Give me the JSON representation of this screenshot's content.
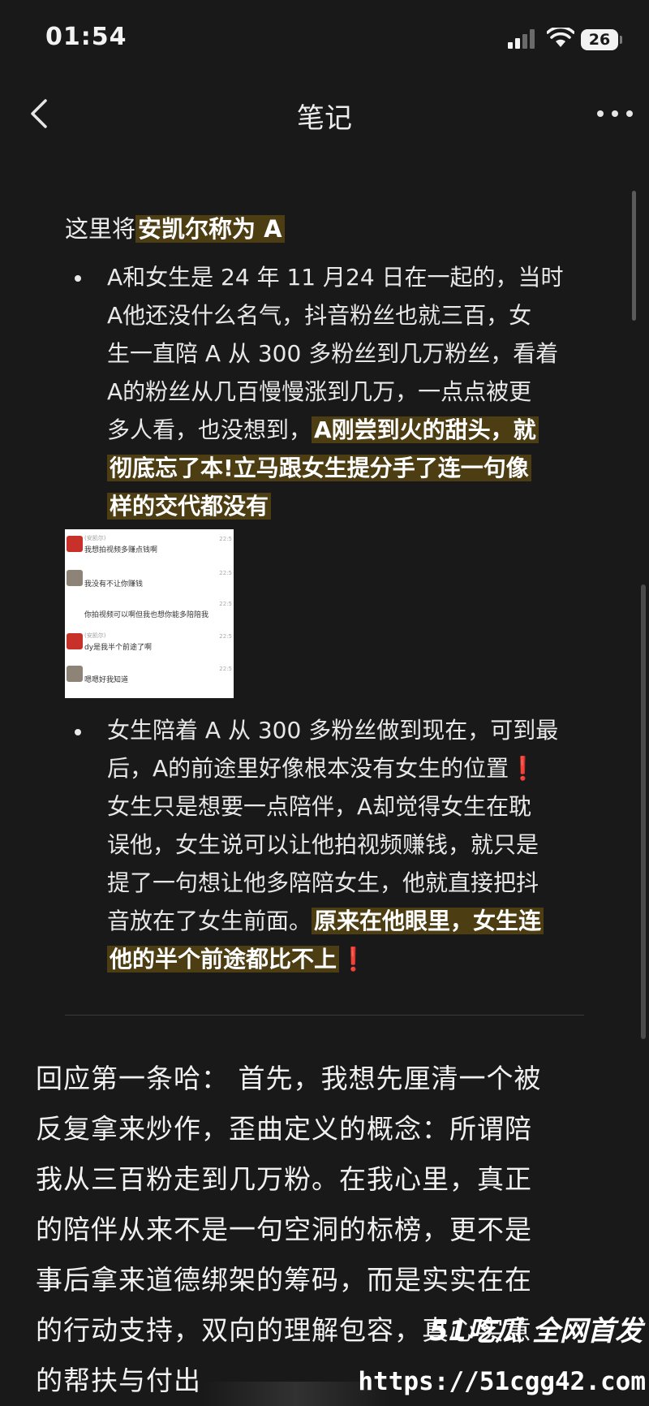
{
  "status_bar": {
    "time": "01:54",
    "battery": "26"
  },
  "nav": {
    "title": "笔记"
  },
  "note": {
    "intro_prefix": "这里将",
    "intro_highlight": "安凯尔称为 A",
    "bullet1": {
      "lines": [
        "A和女生是 24 年 11 月24 日在一起的，当时",
        "A他还没什么名气，抖音粉丝也就三百，女",
        "生一直陪 A 从 300 多粉丝到几万粉丝，看着",
        "A的粉丝从几百慢慢涨到几万，一点点被更"
      ],
      "line5_plain": "多人看，也没想到，",
      "line5_highlight": "A刚尝到火的甜头，就",
      "line6_highlight": "彻底忘了本!立马跟女生提分手了连一句像",
      "line7_highlight": "样的交代都没有"
    },
    "chat_screenshot": {
      "messages": [
        {
          "name": "(安凯尔)",
          "text": "我想拍视频多赚点钱啊",
          "time": "22:5"
        },
        {
          "name": "",
          "text": "我没有不让你赚钱",
          "time": "22:5"
        },
        {
          "name": "",
          "text": "你拍视频可以啊但我也想你能多陪陪我",
          "time": "22:5"
        },
        {
          "name": "(安凯尔)",
          "text": "dy是我半个前途了啊",
          "time": "22:5"
        },
        {
          "name": "",
          "text": "嗯嗯好我知道",
          "time": "22:5"
        }
      ]
    },
    "bullet2": {
      "line1": "女生陪着 A 从 300 多粉丝做到现在，可到最",
      "line2": "后，A的前途里好像根本没有女生的位置",
      "line3": "女生只是想要一点陪伴，A却觉得女生在耽",
      "line4": "误他，女生说可以让他拍视频赚钱，就只是",
      "line5": "提了一句想让他多陪陪女生，他就直接把抖",
      "line6_plain": "音放在了女生前面。",
      "line6_highlight": "原来在他眼里，女生连",
      "line7_highlight": "他的半个前途都比不上",
      "mark": "❗"
    }
  },
  "reply": {
    "lines": [
      "回应第一条哈：  首先，我想先厘清一个被",
      "反复拿来炒作，歪曲定义的概念：所谓陪",
      "我从三百粉走到几万粉。在我心里，真正",
      "的陪伴从来不是一句空洞的标榜，更不是",
      "事后拿来道德绑架的筹码，而是实实在在",
      "的行动支持，双向的理解包容，真心实意",
      "的帮扶与付出"
    ]
  },
  "watermark": {
    "brand": "51吃瓜 全网首发",
    "url": "https://51cgg42.com"
  },
  "colors": {
    "background": "#191919",
    "highlight": "#4c3d13",
    "mark": "#e0342b"
  }
}
